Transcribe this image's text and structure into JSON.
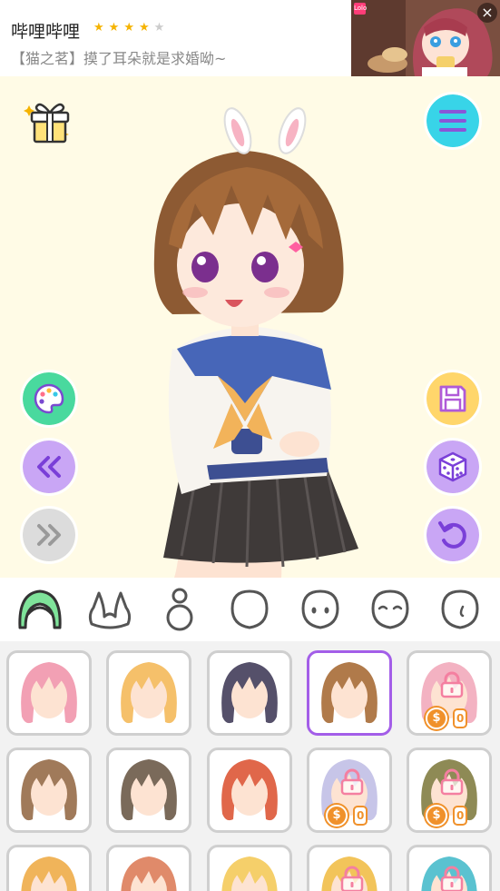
{
  "ad": {
    "app_name": "哔哩哔哩",
    "rating": 4,
    "description": "【猫之茗】摸了耳朵就是求婚呦~",
    "thumb_badge": "Lolo",
    "close_symbol": "×"
  },
  "stage": {
    "background": "#fffbe6",
    "buttons": {
      "gift": "gift-icon",
      "menu": "menu-icon",
      "palette": "palette-icon",
      "prev": "double-chevron-left-icon",
      "next": "double-chevron-right-icon",
      "save": "save-icon",
      "random": "dice-icon",
      "undo": "undo-icon"
    }
  },
  "tabs": [
    {
      "id": "hair",
      "icon": "hair-icon",
      "active": true
    },
    {
      "id": "ears",
      "icon": "bunny-ears-icon",
      "active": false
    },
    {
      "id": "body",
      "icon": "body-icon",
      "active": false
    },
    {
      "id": "face",
      "icon": "face-icon",
      "active": false
    },
    {
      "id": "eyes",
      "icon": "eyes-icon",
      "active": false
    },
    {
      "id": "mouth",
      "icon": "closed-eyes-icon",
      "active": false
    },
    {
      "id": "ear-detail",
      "icon": "ear-icon",
      "active": false
    }
  ],
  "items": [
    {
      "hair": "#f2a0b4",
      "locked": false,
      "selected": false
    },
    {
      "hair": "#f5c06a",
      "locked": false,
      "selected": false
    },
    {
      "hair": "#55506a",
      "locked": false,
      "selected": false
    },
    {
      "hair": "#b07a4a",
      "locked": false,
      "selected": true
    },
    {
      "hair": "#f3b2c2",
      "locked": true,
      "selected": false,
      "coin": "$",
      "price": "0"
    },
    {
      "hair": "#a07a5a",
      "locked": false,
      "selected": false
    },
    {
      "hair": "#7a6a5a",
      "locked": false,
      "selected": false
    },
    {
      "hair": "#e0674a",
      "locked": false,
      "selected": false
    },
    {
      "hair": "#c7c5e8",
      "locked": true,
      "selected": false,
      "coin": "$",
      "price": "0"
    },
    {
      "hair": "#8e8a55",
      "locked": true,
      "selected": false,
      "coin": "$",
      "price": "0"
    },
    {
      "hair": "#f0b45a",
      "locked": false,
      "selected": false
    },
    {
      "hair": "#e08a6a",
      "locked": false,
      "selected": false
    },
    {
      "hair": "#f5cf6a",
      "locked": false,
      "selected": false
    },
    {
      "hair": "#f2c45a",
      "locked": true,
      "selected": false
    },
    {
      "hair": "#5ac2d0",
      "locked": true,
      "selected": false
    }
  ]
}
